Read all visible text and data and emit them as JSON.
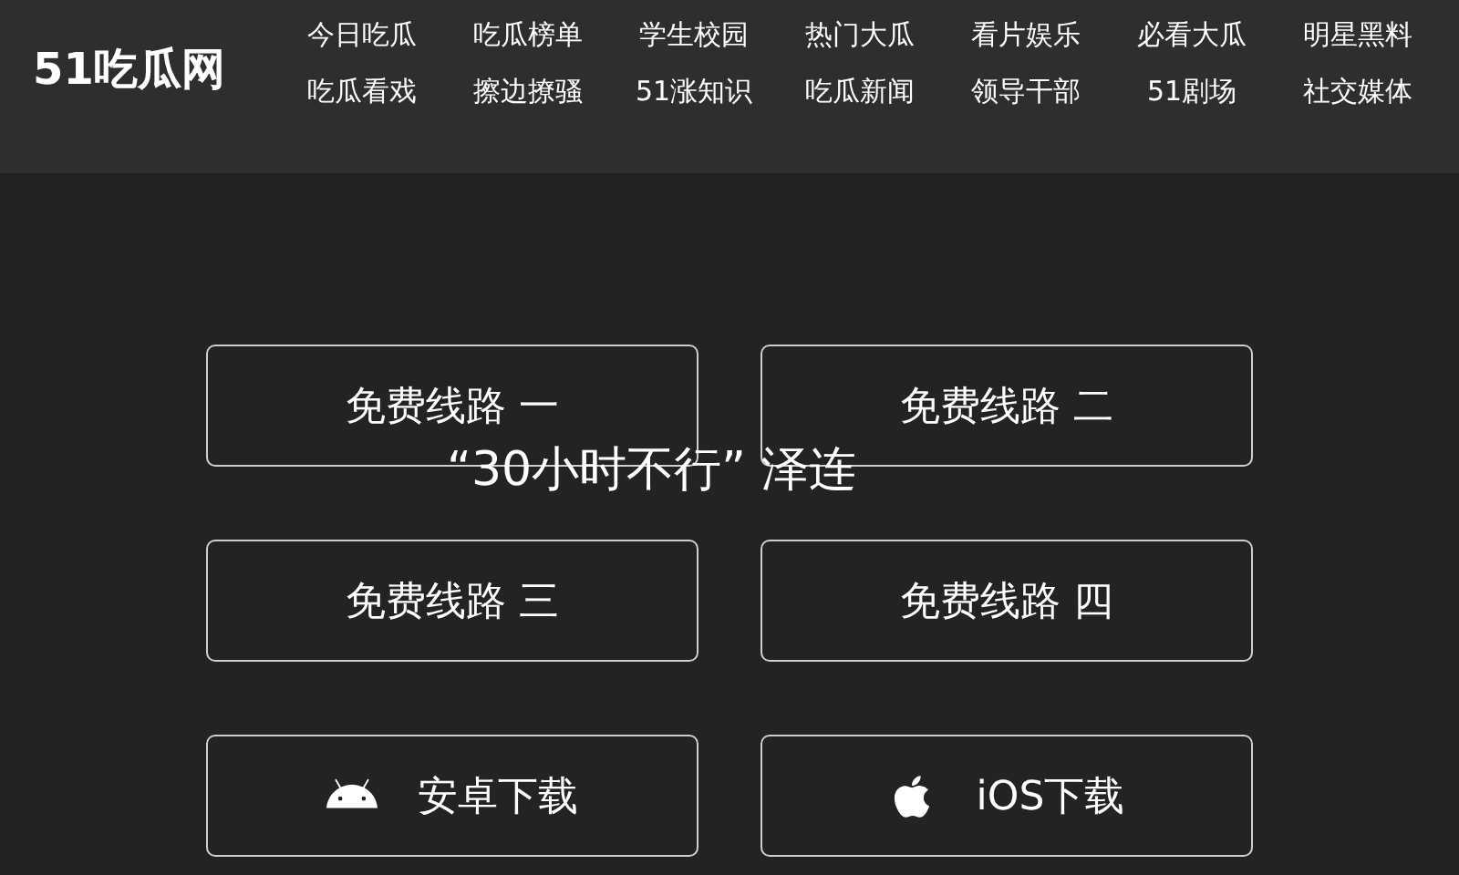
{
  "logo": "51吃瓜网",
  "nav": [
    [
      "今日吃瓜",
      "吃瓜榜单",
      "学生校园",
      "热门大瓜",
      "看片娱乐",
      "必看大瓜",
      "明星黑料"
    ],
    [
      "吃瓜看戏",
      "擦边撩骚",
      "51涨知识",
      "吃瓜新闻",
      "领导干部",
      "51剧场",
      "社交媒体"
    ]
  ],
  "buttons": [
    {
      "kind": "route",
      "label": "免费线路 一"
    },
    {
      "kind": "route",
      "label": "免费线路 二"
    },
    {
      "kind": "route",
      "label": "免费线路 三"
    },
    {
      "kind": "route",
      "label": "免费线路 四"
    },
    {
      "kind": "android",
      "label": "安卓下载"
    },
    {
      "kind": "apple",
      "label": "iOS下载"
    }
  ],
  "headline": "“30小时不行” 泽连"
}
